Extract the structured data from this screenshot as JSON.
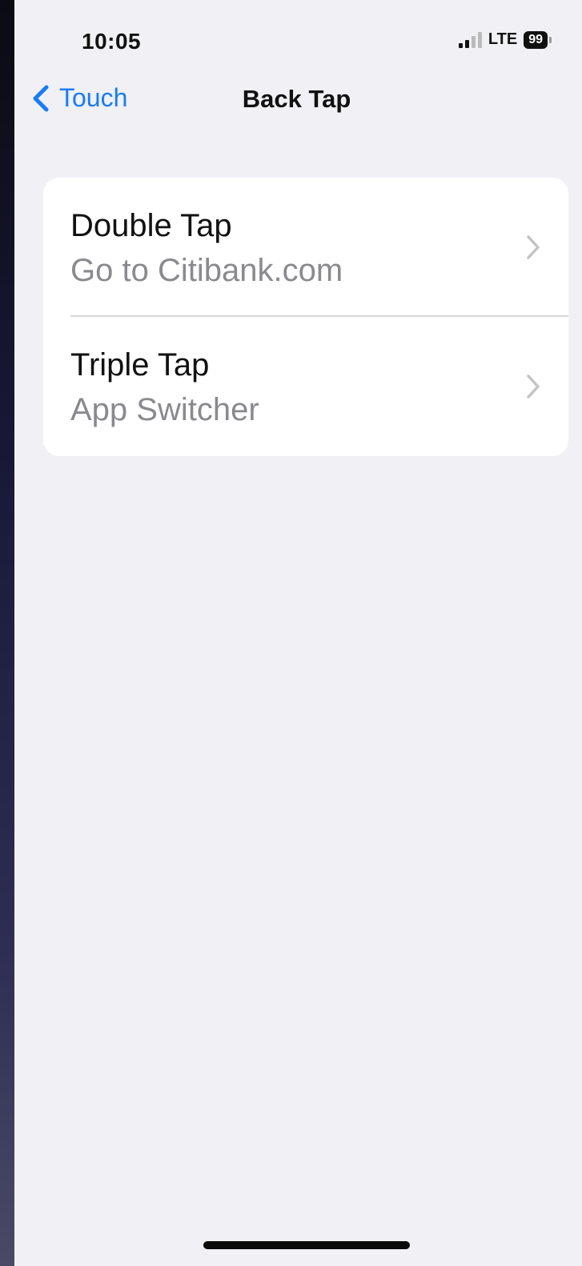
{
  "status_bar": {
    "time": "10:05",
    "network": "LTE",
    "battery": "99"
  },
  "nav": {
    "back_label": "Touch",
    "title": "Back Tap"
  },
  "rows": [
    {
      "title": "Double Tap",
      "value": "Go to Citibank.com"
    },
    {
      "title": "Triple Tap",
      "value": "App Switcher"
    }
  ],
  "colors": {
    "accent": "#1a7cf5",
    "background": "#f0f0f5",
    "card": "#ffffff",
    "secondary_text": "#8a8a8e"
  },
  "icons": {
    "back": "chevron-left-icon",
    "disclosure": "chevron-right-icon",
    "signal": "cellular-signal-icon",
    "battery": "battery-icon"
  }
}
